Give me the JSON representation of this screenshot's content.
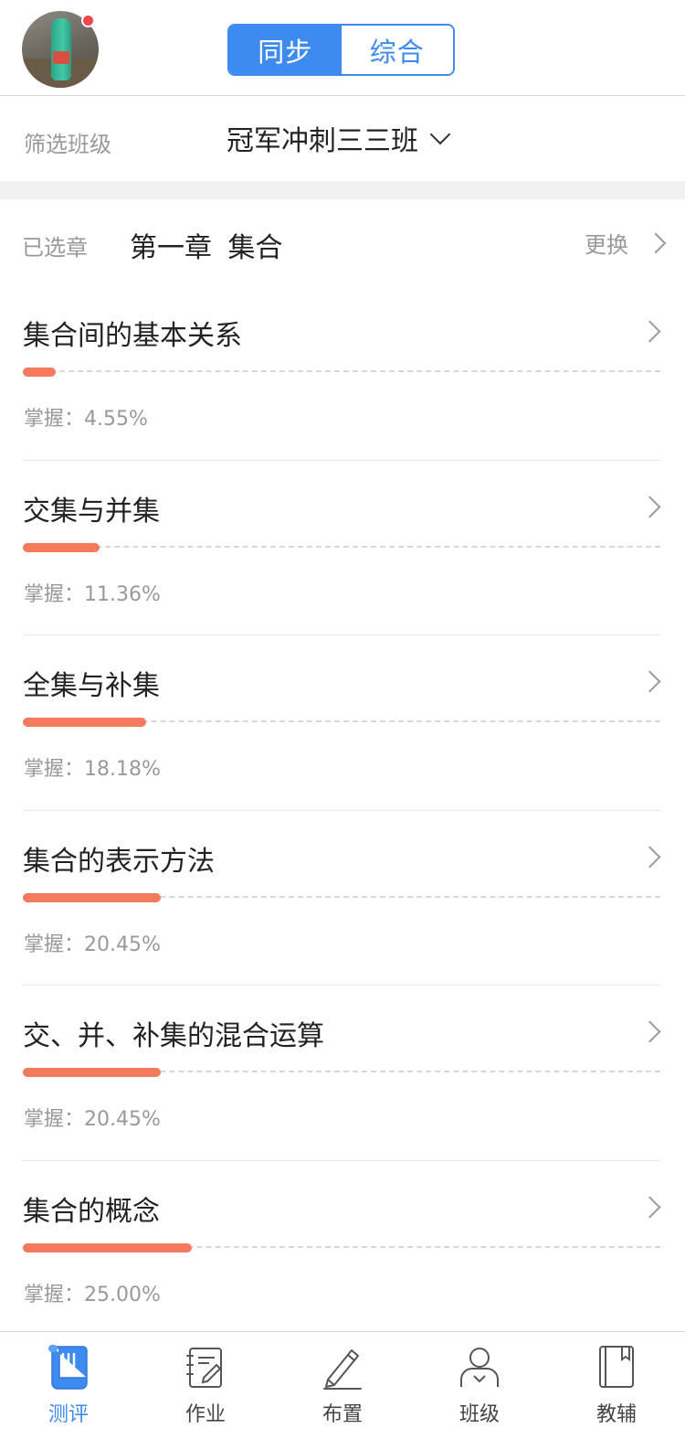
{
  "header": {
    "tabs": [
      {
        "label": "同步",
        "active": true
      },
      {
        "label": "综合",
        "active": false
      }
    ],
    "accent_color": "#3d8bf1"
  },
  "filter": {
    "label": "筛选班级",
    "selected_class": "冠军冲刺三三班"
  },
  "chapter": {
    "label": "已选章",
    "title": "第一章  集合",
    "change_label": "更换"
  },
  "topics": [
    {
      "title": "集合间的基本关系",
      "mastery_text": "掌握：4.55%",
      "mastery": 4.55
    },
    {
      "title": "交集与并集",
      "mastery_text": "掌握：11.36%",
      "mastery": 11.36
    },
    {
      "title": "全集与补集",
      "mastery_text": "掌握：18.18%",
      "mastery": 18.18
    },
    {
      "title": "集合的表示方法",
      "mastery_text": "掌握：20.45%",
      "mastery": 20.45
    },
    {
      "title": "交、并、补集的混合运算",
      "mastery_text": "掌握：20.45%",
      "mastery": 20.45
    },
    {
      "title": "集合的概念",
      "mastery_text": "掌握：25.00%",
      "mastery": 25.0
    }
  ],
  "progress_color": "#f47a5d",
  "nav": [
    {
      "label": "测评",
      "icon": "scroll-icon",
      "active": true
    },
    {
      "label": "作业",
      "icon": "notebook-edit-icon",
      "active": false
    },
    {
      "label": "布置",
      "icon": "pencil-icon",
      "active": false
    },
    {
      "label": "班级",
      "icon": "person-icon",
      "active": false
    },
    {
      "label": "教辅",
      "icon": "book-icon",
      "active": false
    }
  ]
}
